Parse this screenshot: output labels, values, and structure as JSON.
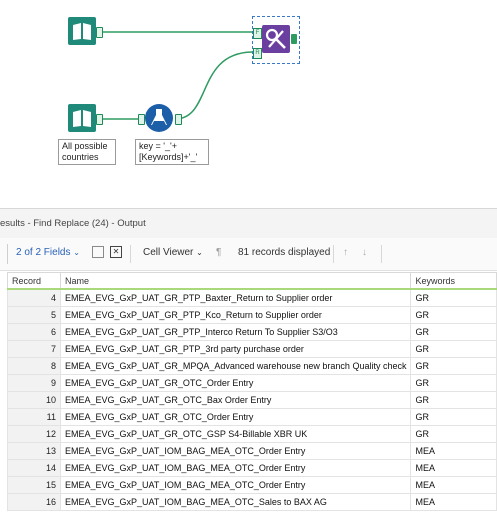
{
  "canvas": {
    "input_label": "All possible\ncountries",
    "formula_label": "key = '_'+\n[Keywords]+'_'",
    "find_anchor": "F",
    "replace_anchor": "R"
  },
  "results": {
    "title": "esults - Find Replace (24) - Output"
  },
  "toolbar": {
    "fields": "2 of 2 Fields",
    "viewer": "Cell Viewer",
    "records": "81 records displayed"
  },
  "table": {
    "headers": [
      "Record",
      "Name",
      "Keywords"
    ],
    "rows": [
      {
        "record": "4",
        "name": "EMEA_EVG_GxP_UAT_GR_PTP_Baxter_Return to Supplier order",
        "keyword": "GR"
      },
      {
        "record": "5",
        "name": "EMEA_EVG_GxP_UAT_GR_PTP_Kco_Return to Supplier order",
        "keyword": "GR"
      },
      {
        "record": "6",
        "name": "EMEA_EVG_GxP_UAT_GR_PTP_Interco Return To Supplier S3/O3",
        "keyword": "GR"
      },
      {
        "record": "7",
        "name": "EMEA_EVG_GxP_UAT_GR_PTP_3rd party purchase order",
        "keyword": "GR"
      },
      {
        "record": "8",
        "name": "EMEA_EVG_GxP_UAT_GR_MPQA_Advanced warehouse new branch Quality check",
        "keyword": "GR"
      },
      {
        "record": "9",
        "name": "EMEA_EVG_GxP_UAT_GR_OTC_Order Entry",
        "keyword": "GR"
      },
      {
        "record": "10",
        "name": "EMEA_EVG_GxP_UAT_GR_OTC_Bax Order Entry",
        "keyword": "GR"
      },
      {
        "record": "11",
        "name": "EMEA_EVG_GxP_UAT_GR_OTC_Order Entry",
        "keyword": "GR"
      },
      {
        "record": "12",
        "name": "EMEA_EVG_GxP_UAT_GR_OTC_GSP S4-Billable XBR UK",
        "keyword": "GR"
      },
      {
        "record": "13",
        "name": "EMEA_EVG_GxP_UAT_IOM_BAG_MEA_OTC_Order Entry",
        "keyword": "MEA"
      },
      {
        "record": "14",
        "name": "EMEA_EVG_GxP_UAT_IOM_BAG_MEA_OTC_Order Entry",
        "keyword": "MEA"
      },
      {
        "record": "15",
        "name": "EMEA_EVG_GxP_UAT_IOM_BAG_MEA_OTC_Order Entry",
        "keyword": "MEA"
      },
      {
        "record": "16",
        "name": "EMEA_EVG_GxP_UAT_IOM_BAG_MEA_OTC_Sales to BAX AG",
        "keyword": "MEA"
      }
    ]
  },
  "colors": {
    "input_tool": "#1f8a7a",
    "formula_tool": "#1c5ea8",
    "find_replace_tool": "#6b3fa0",
    "connection": "#2e9b62"
  }
}
